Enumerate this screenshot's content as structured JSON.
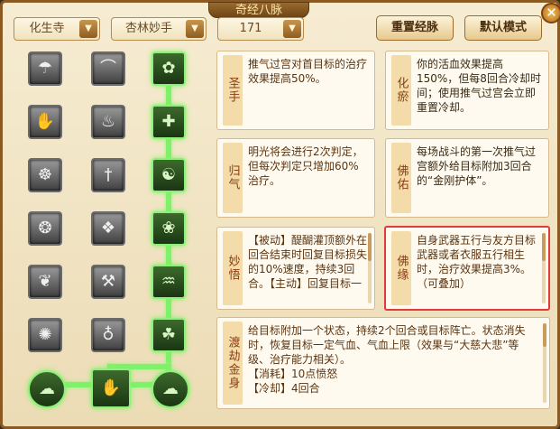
{
  "window": {
    "title": "奇经八脉",
    "close_glyph": "✕"
  },
  "toolbar": {
    "sect_select": "化生寺",
    "school_select": "杏林妙手",
    "level_select": "171",
    "reset_button": "重置经脉",
    "default_button": "默认模式",
    "arrow_glyph": "▼"
  },
  "tree": {
    "grey_icons": [
      "rain-icon",
      "rainbow-icon",
      "horn-icon",
      "monk-icon",
      "claw-icon",
      "seat-icon",
      "sword-icon",
      "buddha-icon",
      "wheel-icon",
      "tools-icon",
      "leaf-icon",
      "gourd-icon"
    ],
    "active_icons": [
      "sage-icon",
      "qi-icon",
      "tiger-icon",
      "lotus-icon",
      "bamboo-icon",
      "beast-icon",
      "cloud-left-icon",
      "ward-icon",
      "cloud-right-icon"
    ]
  },
  "skills": [
    {
      "name": "圣手",
      "desc": "推气过宫对首目标的治疗效果提高50%。"
    },
    {
      "name": "化瘀",
      "desc": "你的活血效果提高150%，但每8回合冷却时间；使用推气过宫会立即重置冷却。"
    },
    {
      "name": "归气",
      "desc": "明光将会进行2次判定，但每次判定只增加60%治疗。"
    },
    {
      "name": "佛佑",
      "desc": "每场战斗的第一次推气过宫额外给目标附加3回合的“金刚护体”。"
    },
    {
      "name": "妙悟",
      "desc": "【被动】醍醐灌顶额外在回合结束时回复目标损失的10%速度，持续3回合。【主动】回复目标一"
    },
    {
      "name": "佛缘",
      "desc": "自身武器五行与友方目标武器或者衣服五行相生时，治疗效果提高3%。（可叠加）"
    },
    {
      "name": "渡劫金身",
      "desc": "给目标附加一个状态，持续2个回合或目标阵亡。状态消失时，恢复目标一定气血、气血上限（效果与“大慈大悲”等级、治疗能力相关）。",
      "cost": "【消耗】10点愤怒",
      "cooldown": "【冷却】4回合"
    }
  ]
}
